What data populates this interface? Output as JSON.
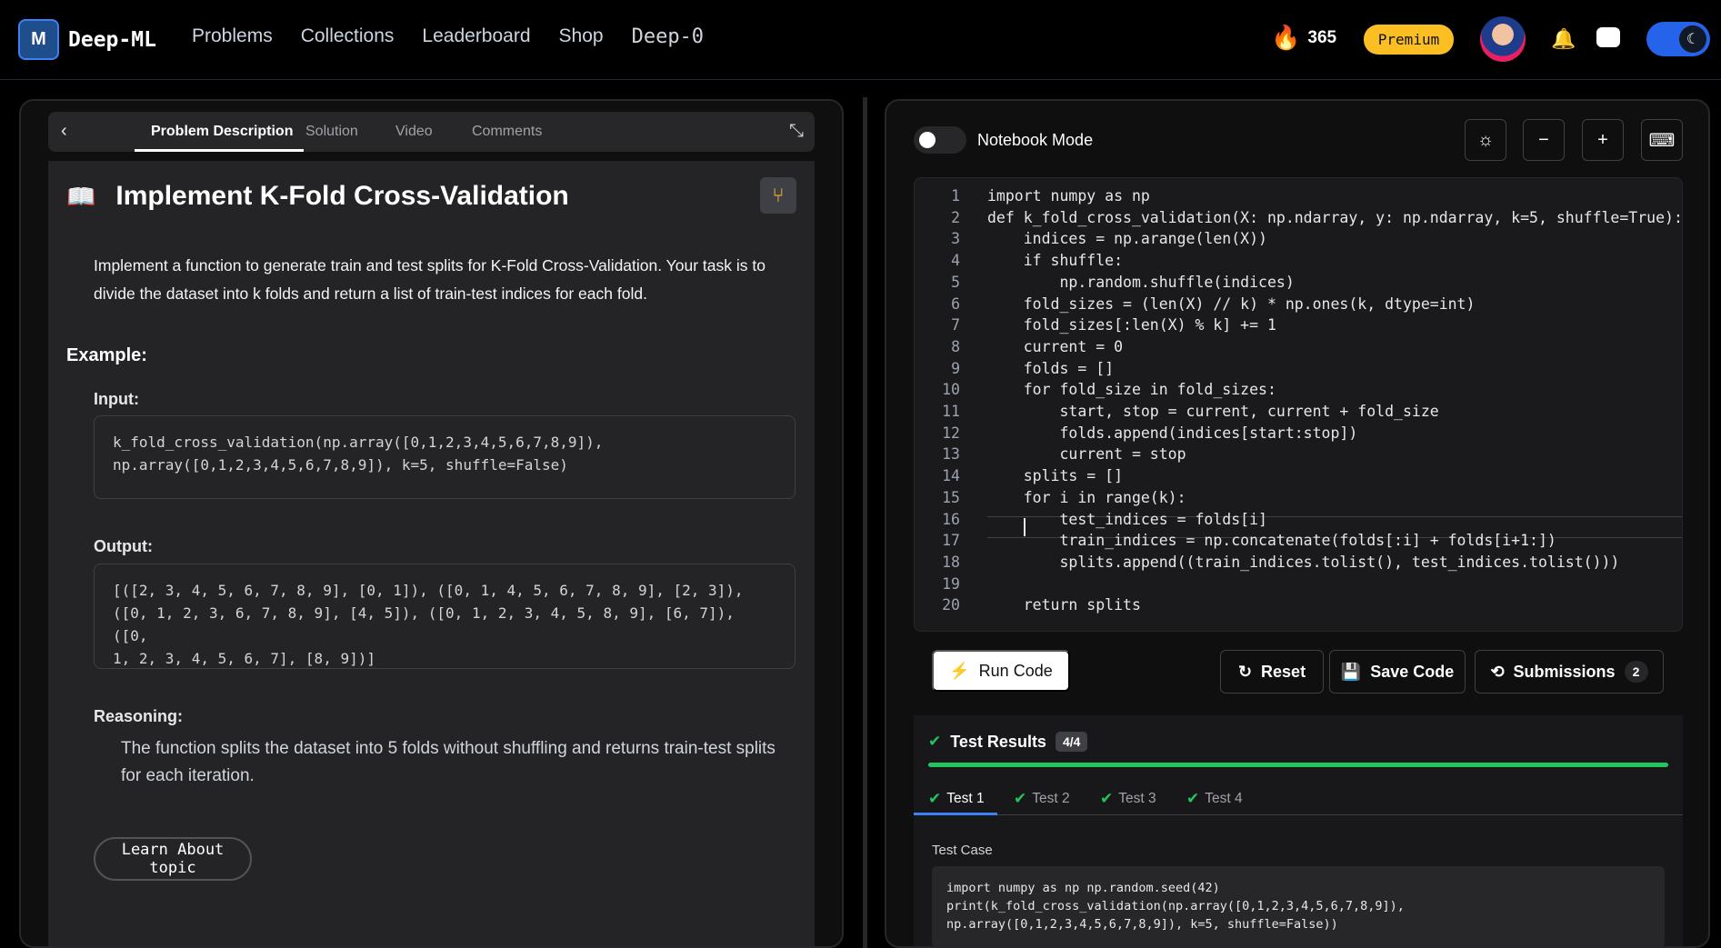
{
  "brand": {
    "logo_text": "Deep-ML",
    "logo_icon": "deep-ml-logo"
  },
  "nav": {
    "links": [
      "Problems",
      "Collections",
      "Leaderboard",
      "Shop",
      "Deep-0"
    ]
  },
  "header": {
    "streak": "365",
    "premium_label": "Premium"
  },
  "left": {
    "tabs": [
      "Problem Description",
      "Solution",
      "Video",
      "Comments"
    ],
    "title": "Implement K-Fold Cross-Validation",
    "description": "Implement a function to generate train and test splits for K-Fold Cross-Validation. Your task is to divide the dataset into k folds and return a list of train-test indices for each fold.",
    "example_heading": "Example:",
    "input_label": "Input:",
    "input_code": "k_fold_cross_validation(np.array([0,1,2,3,4,5,6,7,8,9]),\nnp.array([0,1,2,3,4,5,6,7,8,9]), k=5, shuffle=False)",
    "output_label": "Output:",
    "output_code": "[([2, 3, 4, 5, 6, 7, 8, 9], [0, 1]), ([0, 1, 4, 5, 6, 7, 8, 9], [2, 3]),\n([0, 1, 2, 3, 6, 7, 8, 9], [4, 5]), ([0, 1, 2, 3, 4, 5, 8, 9], [6, 7]), ([0,\n1, 2, 3, 4, 5, 6, 7], [8, 9])]",
    "reasoning_label": "Reasoning:",
    "reasoning": "The function splits the dataset into 5 folds without shuffling and returns train-test splits for each iteration.",
    "learn_button": "Learn About topic"
  },
  "right": {
    "notebook_label": "Notebook Mode",
    "code_lines": [
      "import numpy as np",
      "def k_fold_cross_validation(X: np.ndarray, y: np.ndarray, k=5, shuffle=True):",
      "    indices = np.arange(len(X))",
      "    if shuffle:",
      "        np.random.shuffle(indices)",
      "    fold_sizes = (len(X) // k) * np.ones(k, dtype=int)",
      "    fold_sizes[:len(X) % k] += 1",
      "    current = 0",
      "    folds = []",
      "    for fold_size in fold_sizes:",
      "        start, stop = current, current + fold_size",
      "        folds.append(indices[start:stop])",
      "        current = stop",
      "    splits = []",
      "    for i in range(k):",
      "        test_indices = folds[i]",
      "        train_indices = np.concatenate(folds[:i] + folds[i+1:])",
      "        splits.append((train_indices.tolist(), test_indices.tolist()))",
      "    ",
      "    return splits"
    ],
    "run_label": "Run Code",
    "reset_label": "Reset",
    "save_label": "Save Code",
    "submissions_label": "Submissions",
    "submissions_count": "2",
    "results_title": "Test Results",
    "results_badge": "4/4",
    "results_progress": 1.0,
    "test_tabs": [
      "Test 1",
      "Test 2",
      "Test 3",
      "Test 4"
    ],
    "test_case_label": "Test Case",
    "test_case_code": "import numpy as np np.random.seed(42)\nprint(k_fold_cross_validation(np.array([0,1,2,3,4,5,6,7,8,9]),\nnp.array([0,1,2,3,4,5,6,7,8,9]), k=5, shuffle=False))"
  },
  "colors": {
    "accent": "#2563eb",
    "success": "#22c55e",
    "premium": "#fbbf24",
    "panel": "#242426"
  }
}
